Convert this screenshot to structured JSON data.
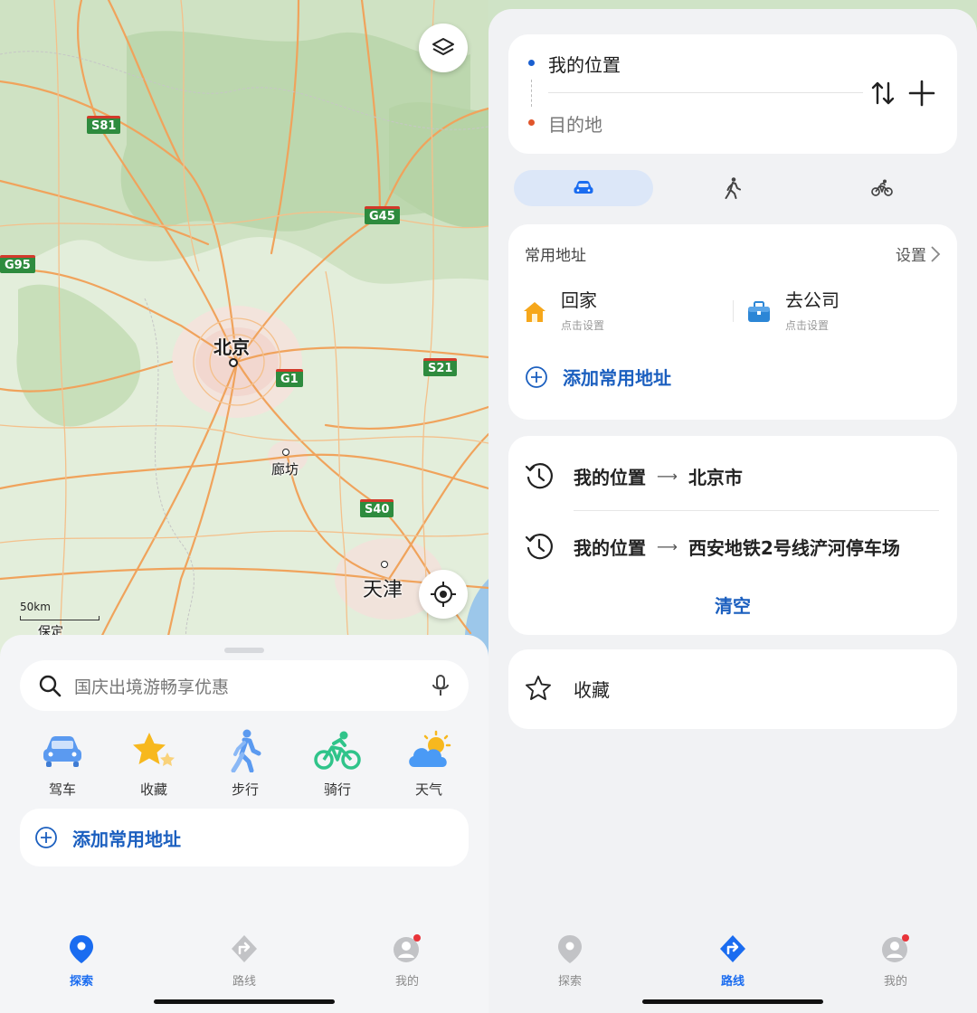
{
  "left": {
    "map": {
      "highway_shields": [
        "S81",
        "G45",
        "G95",
        "S21",
        "G1",
        "S40"
      ],
      "cities": {
        "beijing": "北京",
        "langfang": "廊坊",
        "tianjin": "天津",
        "baoding": "保定"
      },
      "scale_label": "50km",
      "layers_button_icon": "layers-icon",
      "locate_button_icon": "locate-icon"
    },
    "search": {
      "placeholder": "国庆出境游畅享优惠",
      "search_icon": "search-icon",
      "mic_icon": "microphone-icon"
    },
    "quick_actions": [
      {
        "label": "驾车",
        "icon": "car-icon",
        "color": "#5b9af0"
      },
      {
        "label": "收藏",
        "icon": "star-icon",
        "color": "#f7b81e"
      },
      {
        "label": "步行",
        "icon": "walk-icon",
        "color": "#5b9af0"
      },
      {
        "label": "骑行",
        "icon": "bike-icon",
        "color": "#30c48a"
      },
      {
        "label": "天气",
        "icon": "weather-icon",
        "color": "#4a9af5"
      }
    ],
    "add_common_address": "添加常用地址",
    "tabs": [
      {
        "label": "探索",
        "icon": "location-pin-icon",
        "active": true
      },
      {
        "label": "路线",
        "icon": "route-icon",
        "active": false
      },
      {
        "label": "我的",
        "icon": "profile-icon",
        "active": false
      }
    ]
  },
  "right": {
    "route": {
      "origin": "我的位置",
      "destination": "目的地",
      "swap_icon": "swap-icon",
      "add_icon": "plus-icon"
    },
    "modes": [
      {
        "icon": "car-icon",
        "active": true
      },
      {
        "icon": "walk-icon",
        "active": false
      },
      {
        "icon": "bike-icon",
        "active": false
      }
    ],
    "common_addresses": {
      "title": "常用地址",
      "settings_label": "设置",
      "home": {
        "name": "回家",
        "hint": "点击设置"
      },
      "work": {
        "name": "去公司",
        "hint": "点击设置"
      },
      "add_label": "添加常用地址"
    },
    "history": [
      {
        "from": "我的位置",
        "to": "北京市"
      },
      {
        "from": "我的位置",
        "to": "西安地铁2号线浐河停车场"
      }
    ],
    "clear_label": "清空",
    "favorites_label": "收藏",
    "tabs": [
      {
        "label": "探索",
        "icon": "location-pin-icon",
        "active": false
      },
      {
        "label": "路线",
        "icon": "route-icon",
        "active": true
      },
      {
        "label": "我的",
        "icon": "profile-icon",
        "active": false
      }
    ]
  },
  "colors": {
    "accent": "#1a6cf0",
    "link_blue": "#1b5fbf",
    "origin_dot": "#1a5fd0",
    "destination_dot": "#e0552b"
  }
}
